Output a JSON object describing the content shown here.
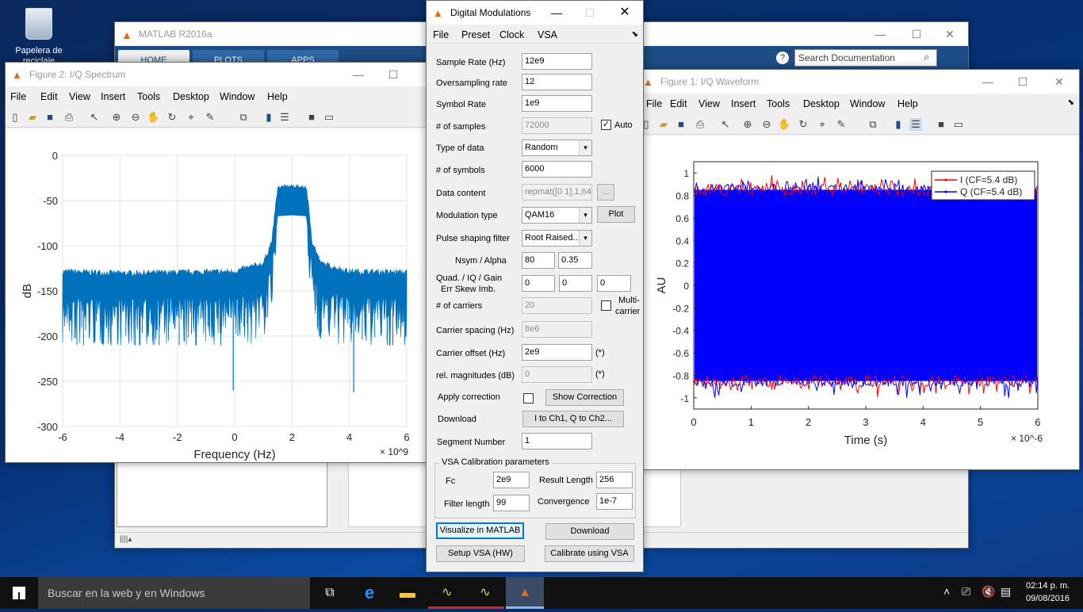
{
  "desktop": {
    "recycle_bin_label": "Papelera de reciclaje"
  },
  "matlab": {
    "title": "MATLAB R2016a",
    "tabs": [
      "HOME",
      "PLOTS",
      "APPS"
    ],
    "search_placeholder": "Search Documentation"
  },
  "fig2": {
    "title": "Figure 2: I/Q Spectrum",
    "menus": [
      "File",
      "Edit",
      "View",
      "Insert",
      "Tools",
      "Desktop",
      "Window",
      "Help"
    ]
  },
  "fig1": {
    "title": "Figure 1: I/Q Waveform",
    "menus": [
      "File",
      "Edit",
      "View",
      "Insert",
      "Tools",
      "Desktop",
      "Window",
      "Help"
    ]
  },
  "dialog": {
    "title": "Digital Modulations",
    "menus": [
      "File",
      "Preset",
      "Clock",
      "VSA"
    ],
    "sample_rate_label": "Sample Rate (Hz)",
    "sample_rate": "12e9",
    "oversampling_label": "Oversampling rate",
    "oversampling": "12",
    "symbol_rate_label": "Symbol Rate",
    "symbol_rate": "1e9",
    "samples_label": "# of samples",
    "samples": "72000",
    "auto_label": "Auto",
    "type_label": "Type of data",
    "type_value": "Random",
    "symbols_label": "# of symbols",
    "symbols": "6000",
    "content_label": "Data content",
    "content": "repmat([0 1],1,64)",
    "content_btn": "...",
    "mod_label": "Modulation type",
    "mod_value": "QAM16",
    "plot_btn": "Plot",
    "pulse_label": "Pulse shaping filter",
    "pulse_value": "Root Raised...",
    "nsym_label": "Nsym / Alpha",
    "nsym": "80",
    "alpha": "0.35",
    "quad_label": "Quad. /  IQ   /  Gain",
    "quad_label2": "Err     Skew    Imb.",
    "quad": "0",
    "iq": "0",
    "gain": "0",
    "carriers_label": "# of carriers",
    "carriers": "20",
    "multi_label": "Multi-",
    "multi_label2": "carrier",
    "spacing_label": "Carrier spacing (Hz)",
    "spacing": "8e6",
    "offset_label": "Carrier offset (Hz)",
    "offset": "2e9",
    "star": "(*)",
    "relmag_label": "rel. magnitudes (dB)",
    "relmag": "0",
    "apply_label": "Apply correction",
    "show_corr_btn": "Show Correction",
    "download_label": "Download",
    "download_sel": "I to Ch1, Q to Ch2...",
    "segment_label": "Segment Number",
    "segment": "1",
    "vsa_group": "VSA Calibration parameters",
    "fc_label": "Fc",
    "fc": "2e9",
    "result_len_label": "Result Length",
    "result_len": "256",
    "filter_len_label": "Filter length",
    "filter_len": "99",
    "conv_label": "Convergence",
    "conv": "1e-7",
    "visualize_btn": "Visualize in MATLAB",
    "download_btn": "Download",
    "setup_btn": "Setup VSA (HW)",
    "calibrate_btn": "Calibrate using VSA"
  },
  "taskbar": {
    "search_placeholder": "Buscar en la web y en Windows",
    "time": "02:14 p. m.",
    "date": "09/08/2016"
  },
  "chart_data": [
    {
      "type": "line",
      "xlabel": "Frequency (Hz)",
      "ylabel": "dB",
      "x_exponent": "× 10^9",
      "xlim": [
        -6,
        6
      ],
      "ylim": [
        -300,
        0
      ],
      "xticks": [
        "-6",
        "-4",
        "-2",
        "0",
        "2",
        "4",
        "6"
      ],
      "yticks": [
        "0",
        "-50",
        "-100",
        "-150",
        "-200",
        "-250",
        "-300"
      ],
      "series": [
        {
          "color": "#0072bd",
          "x": [
            -6,
            -4,
            -2,
            0,
            1.0,
            1.3,
            1.5,
            2.0,
            2.5,
            2.7,
            3.0,
            4,
            6
          ],
          "y": [
            -132,
            -134,
            -133,
            -132,
            -123,
            -98,
            -37,
            -36,
            -37,
            -98,
            -123,
            -132,
            -133
          ],
          "noise_floor_min": -210,
          "spurs": [
            [
              -0.05,
              -260
            ],
            [
              4.15,
              -262
            ]
          ]
        }
      ],
      "grid": true
    },
    {
      "type": "line",
      "xlabel": "Time (s)",
      "ylabel": "AU",
      "x_exponent": "× 10^-6",
      "xlim": [
        0,
        6
      ],
      "ylim": [
        -1.1,
        1.1
      ],
      "xticks": [
        "0",
        "1",
        "2",
        "3",
        "4",
        "5",
        "6"
      ],
      "yticks": [
        "1",
        "0.8",
        "0.6",
        "0.4",
        "0.2",
        "0",
        "-0.2",
        "-0.4",
        "-0.6",
        "-0.8",
        "-1"
      ],
      "legend": [
        "I (CF=5.4 dB)",
        "Q (CF=5.4 dB)"
      ],
      "legend_position": "top-right",
      "series": [
        {
          "name": "I (CF=5.4 dB)",
          "color": "#ff0000",
          "envelope": [
            -0.85,
            0.85
          ],
          "peak": 1.0
        },
        {
          "name": "Q (CF=5.4 dB)",
          "color": "#0000ff",
          "envelope": [
            -0.85,
            0.85
          ],
          "peak": 1.0
        }
      ],
      "grid": false
    }
  ]
}
